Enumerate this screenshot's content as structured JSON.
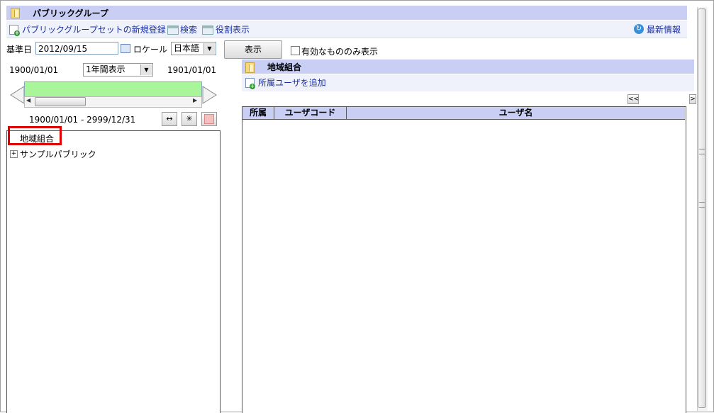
{
  "header": {
    "title": "パブリックグループ"
  },
  "toolbar": {
    "new_register": "パブリックグループセットの新規登録",
    "search": "検索",
    "role_display": "役割表示",
    "latest_info": "最新情報"
  },
  "filter": {
    "base_date_label": "基準日",
    "base_date_value": "2012/09/15",
    "locale_label": "ロケール",
    "locale_value": "日本語",
    "show_button": "表示",
    "active_only_label": "有効なもののみ表示"
  },
  "timeline": {
    "start": "1900/01/01",
    "period": "1年間表示",
    "end": "1901/01/01",
    "range": "1900/01/01 - 2999/12/31"
  },
  "tree": {
    "items": [
      {
        "label": "地域組合"
      },
      {
        "label": "サンプルパブリック"
      }
    ]
  },
  "right": {
    "title": "地域組合",
    "add_user": "所属ユーザを追加",
    "pager_prev": "<<",
    "pager_next": ">",
    "columns": [
      "所属",
      "ユーザコード",
      "ユーザ名"
    ]
  },
  "colors": {
    "header_bg": "#c9cef5",
    "link": "#1a2fa0",
    "highlight": "#e00000",
    "timeline_bar": "#a8f59a"
  }
}
